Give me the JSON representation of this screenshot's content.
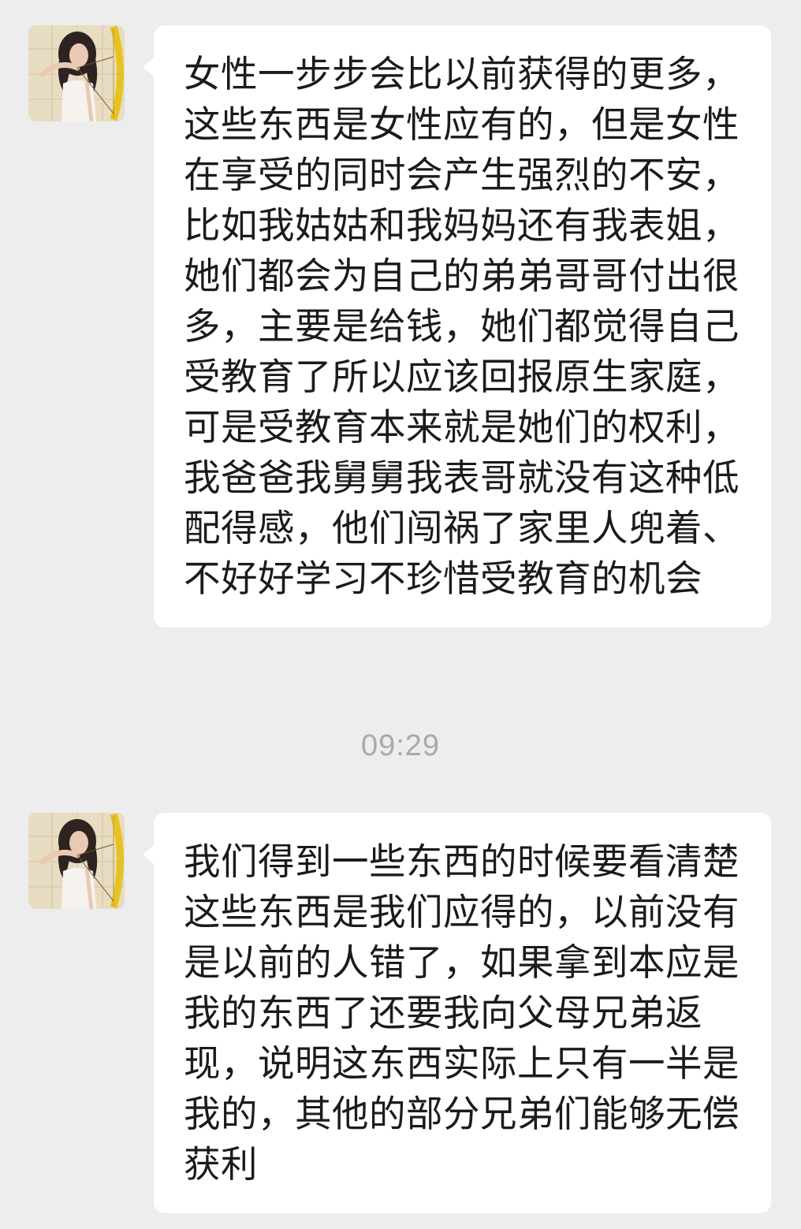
{
  "messages": [
    {
      "sender_avatar": "avatar-girl-with-bow-icon",
      "text": "女性一步步会比以前获得的更多，这些东西是女性应有的，但是女性在享受的同时会产生强烈的不安，比如我姑姑和我妈妈还有我表姐，她们都会为自己的弟弟哥哥付出很多，主要是给钱，她们都觉得自己受教育了所以应该回报原生家庭，可是受教育本来就是她们的权利，我爸爸我舅舅我表哥就没有这种低配得感，他们闯祸了家里人兜着、不好好学习不珍惜受教育的机会"
    },
    {
      "sender_avatar": "avatar-girl-with-bow-icon",
      "text": "我们得到一些东西的时候要看清楚这些东西是我们应得的，以前没有是以前的人错了，如果拿到本应是我的东西了还要我向父母兄弟返现，说明这东西实际上只有一半是我的，其他的部分兄弟们能够无偿获利"
    }
  ],
  "timestamp": "09:29",
  "colors": {
    "background": "#ededed",
    "bubble": "#ffffff",
    "text": "#1b1b1b",
    "timestamp": "#a9a9a9"
  }
}
